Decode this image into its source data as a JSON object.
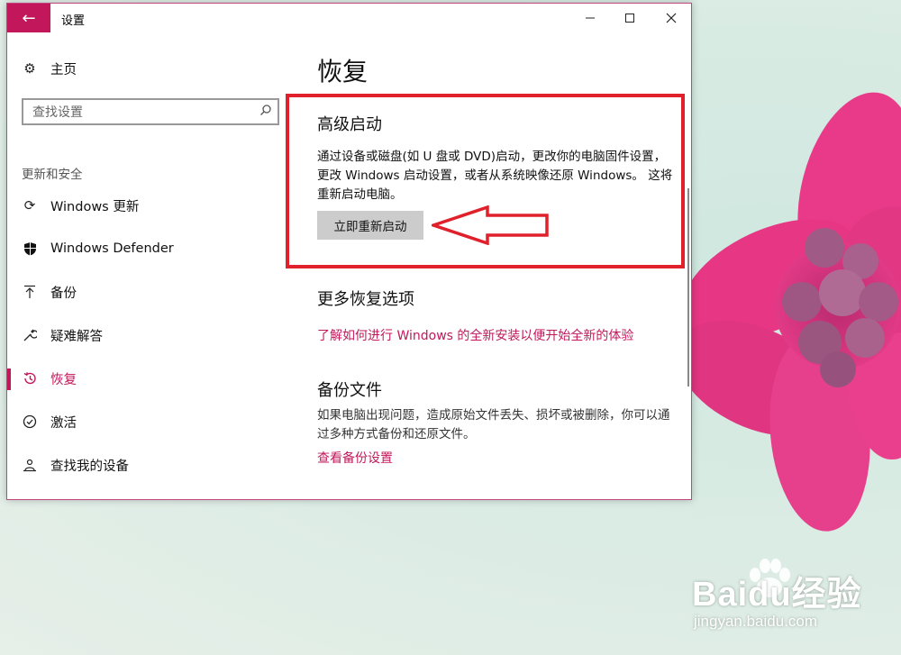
{
  "window": {
    "title": "设置",
    "back_icon": "back-arrow-icon",
    "minimize_icon": "minimize-icon",
    "maximize_icon": "maximize-icon",
    "close_icon": "close-icon"
  },
  "sidebar": {
    "home": {
      "label": "主页",
      "icon": "gear-icon"
    },
    "search": {
      "placeholder": "查找设置",
      "icon": "search-icon"
    },
    "section_label": "更新和安全",
    "items": [
      {
        "label": "Windows 更新",
        "icon": "refresh-icon",
        "active": false
      },
      {
        "label": "Windows Defender",
        "icon": "shield-icon",
        "active": false
      },
      {
        "label": "备份",
        "icon": "upload-arrow-icon",
        "active": false
      },
      {
        "label": "疑难解答",
        "icon": "wrench-icon",
        "active": false
      },
      {
        "label": "恢复",
        "icon": "history-icon",
        "active": true
      },
      {
        "label": "激活",
        "icon": "check-circle-icon",
        "active": false
      },
      {
        "label": "查找我的设备",
        "icon": "person-pin-icon",
        "active": false
      }
    ]
  },
  "content": {
    "page_title": "恢复",
    "advanced_startup": {
      "heading": "高级启动",
      "description": "通过设备或磁盘(如 U 盘或 DVD)启动，更改你的电脑固件设置，更改 Windows 启动设置，或者从系统映像还原 Windows。 这将重新启动电脑。",
      "button_label": "立即重新启动"
    },
    "more_options": {
      "heading": "更多恢复选项",
      "link": "了解如何进行 Windows 的全新安装以便开始全新的体验"
    },
    "backup": {
      "heading": "备份文件",
      "description": "如果电脑出现问题，造成原始文件丢失、损坏或被删除，你可以通过多种方式备份和还原文件。",
      "link": "查看备份设置"
    }
  },
  "watermark": {
    "brand": "Baidu经验",
    "url": "jingyan.baidu.com"
  },
  "colors": {
    "accent": "#c2185b",
    "highlight": "#e0202a"
  }
}
